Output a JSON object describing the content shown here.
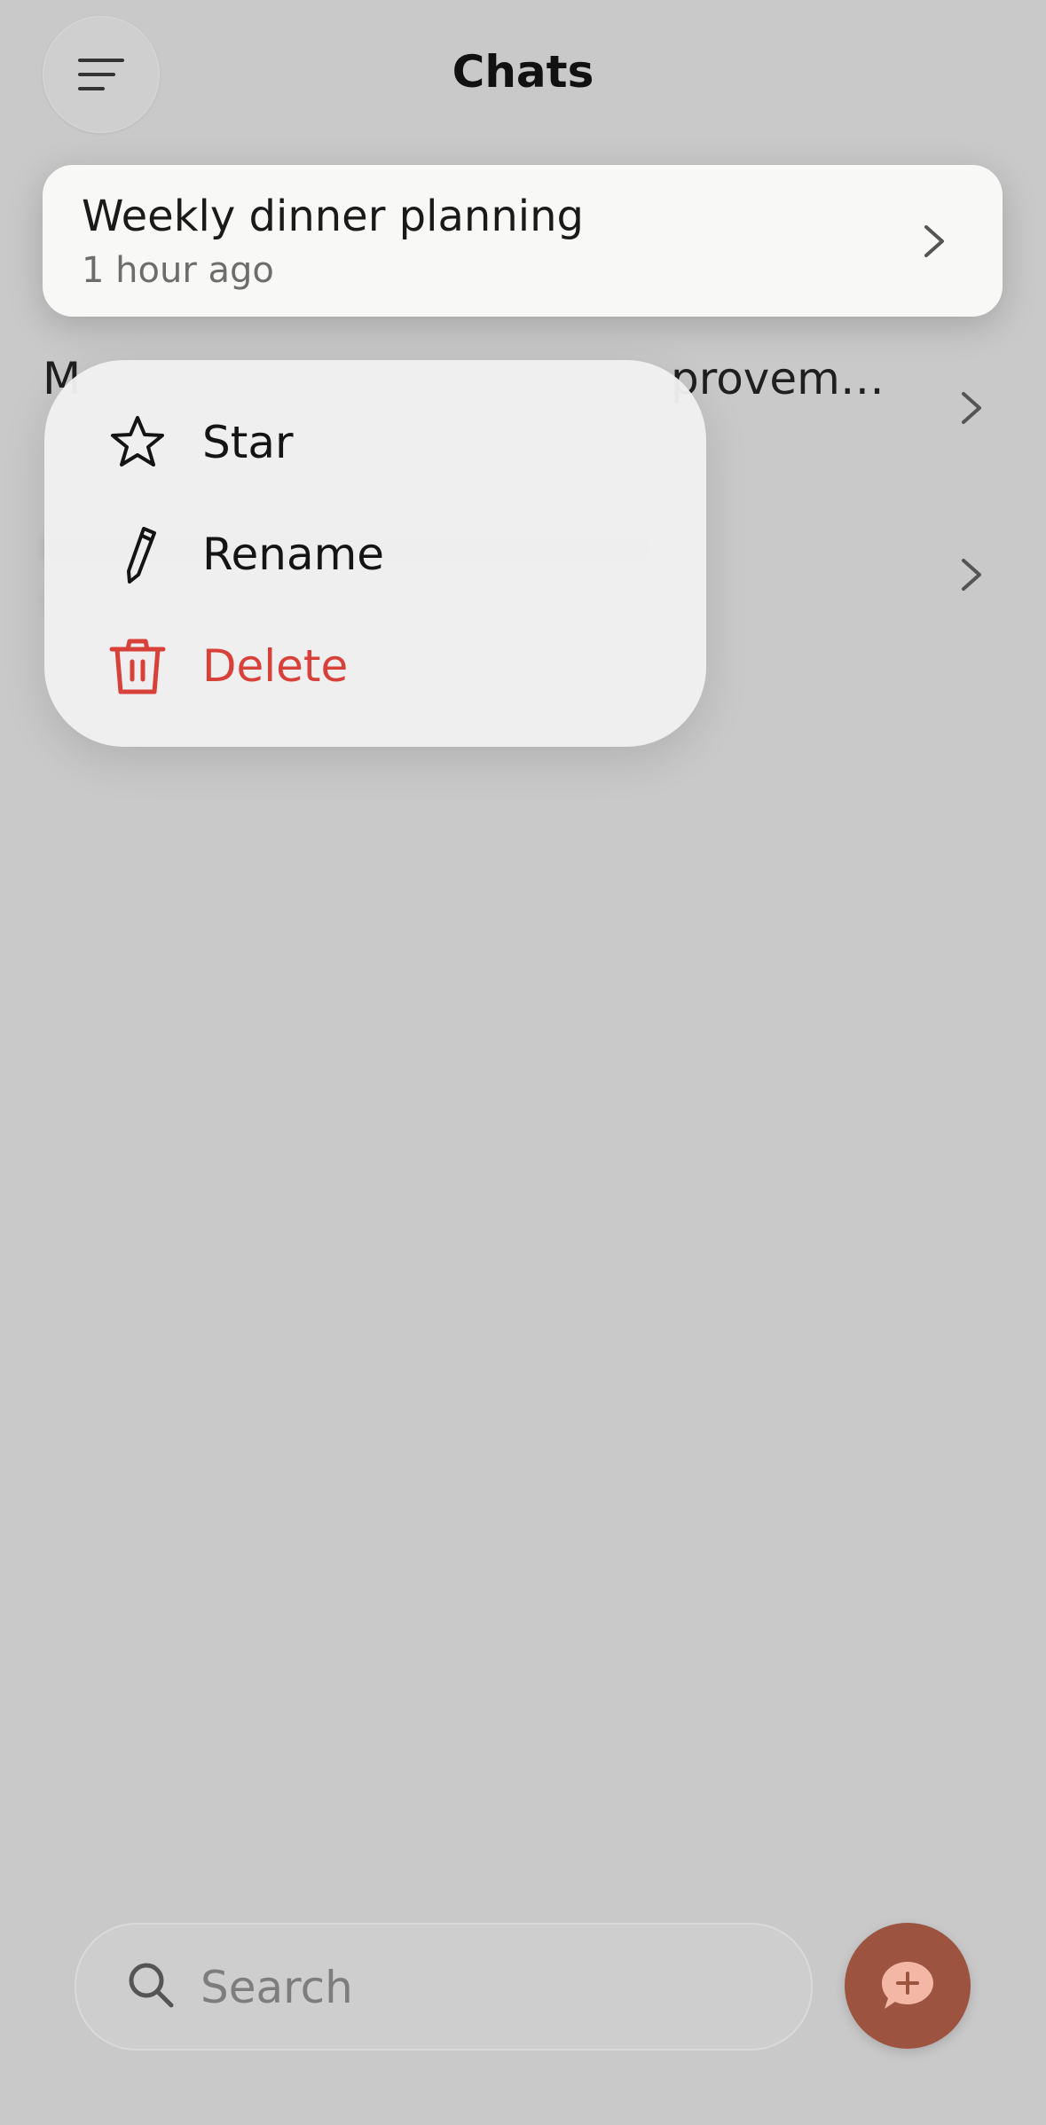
{
  "header": {
    "title": "Chats",
    "menu_icon": "menu-lines-icon"
  },
  "chats": [
    {
      "title": "Weekly dinner planning",
      "time": "1 hour ago"
    },
    {
      "title_start": "M",
      "title_end": "provem…"
    }
  ],
  "context_menu": {
    "items": [
      {
        "label": "Star",
        "icon": "star-icon"
      },
      {
        "label": "Rename",
        "icon": "pencil-icon"
      },
      {
        "label": "Delete",
        "icon": "trash-icon",
        "color": "#d8403a"
      }
    ]
  },
  "search": {
    "placeholder": "Search",
    "value": ""
  },
  "fab": {
    "icon": "new-chat-icon",
    "color": "#9c5441"
  },
  "colors": {
    "background": "#c9c9c9",
    "card": "#f8f8f6",
    "danger": "#d8403a",
    "accent": "#9c5441"
  }
}
